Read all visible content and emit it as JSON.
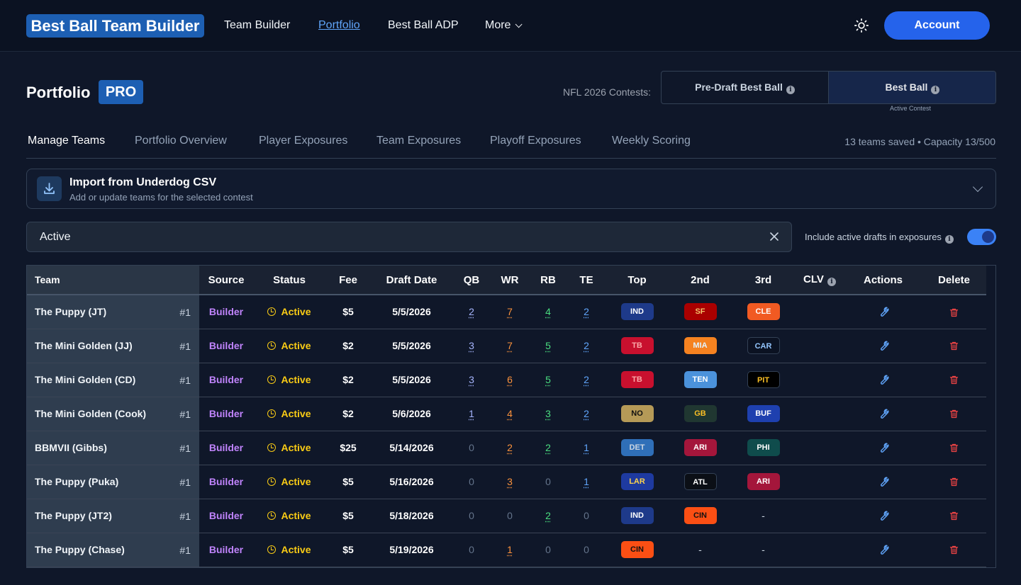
{
  "brand": "Best Ball Team Builder",
  "nav": {
    "team_builder": "Team Builder",
    "portfolio": "Portfolio",
    "adp": "Best Ball ADP",
    "more": "More"
  },
  "account_label": "Account",
  "page": {
    "title": "Portfolio",
    "badge": "PRO",
    "contest_label": "NFL 2026 Contests:",
    "contest_options": [
      "Pre-Draft Best Ball",
      "Best Ball"
    ],
    "active_contest_note": "Active Contest"
  },
  "tabs": [
    "Manage Teams",
    "Portfolio Overview",
    "Player Exposures",
    "Team Exposures",
    "Playoff Exposures",
    "Weekly Scoring"
  ],
  "saved_info": "13 teams saved • Capacity 13/500",
  "import": {
    "title": "Import from Underdog CSV",
    "subtitle": "Add or update teams for the selected contest"
  },
  "filter": {
    "value": "Active",
    "include_label": "Include active drafts in exposures",
    "include_on": true
  },
  "table": {
    "headers": [
      "Team",
      "Source",
      "Status",
      "Fee",
      "Draft Date",
      "QB",
      "WR",
      "RB",
      "TE",
      "Top",
      "2nd",
      "3rd",
      "CLV",
      "Actions",
      "Delete"
    ],
    "rows": [
      {
        "team": "The Puppy (JT)",
        "rank": "#1",
        "source": "Builder",
        "status": "Active",
        "fee": "$5",
        "date": "5/5/2026",
        "qb": "2",
        "wr": "7",
        "rb": "4",
        "te": "2",
        "top": "IND",
        "second": "SF",
        "third": "CLE"
      },
      {
        "team": "The Mini Golden (JJ)",
        "rank": "#1",
        "source": "Builder",
        "status": "Active",
        "fee": "$2",
        "date": "5/5/2026",
        "qb": "3",
        "wr": "7",
        "rb": "5",
        "te": "2",
        "top": "TB",
        "second": "MIA",
        "third": "CAR"
      },
      {
        "team": "The Mini Golden (CD)",
        "rank": "#1",
        "source": "Builder",
        "status": "Active",
        "fee": "$2",
        "date": "5/5/2026",
        "qb": "3",
        "wr": "6",
        "rb": "5",
        "te": "2",
        "top": "TB",
        "second": "TEN",
        "third": "PIT"
      },
      {
        "team": "The Mini Golden (Cook)",
        "rank": "#1",
        "source": "Builder",
        "status": "Active",
        "fee": "$2",
        "date": "5/6/2026",
        "qb": "1",
        "wr": "4",
        "rb": "3",
        "te": "2",
        "top": "NO",
        "second": "GB",
        "third": "BUF"
      },
      {
        "team": "BBMVII (Gibbs)",
        "rank": "#1",
        "source": "Builder",
        "status": "Active",
        "fee": "$25",
        "date": "5/14/2026",
        "qb": "0",
        "wr": "2",
        "rb": "2",
        "te": "1",
        "top": "DET",
        "second": "ARI",
        "third": "PHI"
      },
      {
        "team": "The Puppy (Puka)",
        "rank": "#1",
        "source": "Builder",
        "status": "Active",
        "fee": "$5",
        "date": "5/16/2026",
        "qb": "0",
        "wr": "3",
        "rb": "0",
        "te": "1",
        "top": "LAR",
        "second": "ATL",
        "third": "ARI"
      },
      {
        "team": "The Puppy (JT2)",
        "rank": "#1",
        "source": "Builder",
        "status": "Active",
        "fee": "$5",
        "date": "5/18/2026",
        "qb": "0",
        "wr": "0",
        "rb": "2",
        "te": "0",
        "top": "IND",
        "second": "CIN",
        "third": "-"
      },
      {
        "team": "The Puppy (Chase)",
        "rank": "#1",
        "source": "Builder",
        "status": "Active",
        "fee": "$5",
        "date": "5/19/2026",
        "qb": "0",
        "wr": "1",
        "rb": "0",
        "te": "0",
        "top": "CIN",
        "second": "-",
        "third": "-"
      }
    ]
  },
  "team_colors": {
    "IND": {
      "bg": "#1e3a8a",
      "fg": "#ffffff"
    },
    "SF": {
      "bg": "#aa0000",
      "fg": "#f4c26b"
    },
    "CLE": {
      "bg": "#f15a22",
      "fg": "#ffffff"
    },
    "TB": {
      "bg": "#c8102e",
      "fg": "#f9a8a8"
    },
    "MIA": {
      "bg": "#f58220",
      "fg": "#e0f2fe"
    },
    "CAR": {
      "bg": "#0b1222",
      "fg": "#93c5fd"
    },
    "TEN": {
      "bg": "#4b92db",
      "fg": "#ffffff"
    },
    "PIT": {
      "bg": "#000000",
      "fg": "#fbbf24"
    },
    "NO": {
      "bg": "#b59a57",
      "fg": "#111111"
    },
    "GB": {
      "bg": "#203731",
      "fg": "#fbbf24"
    },
    "BUF": {
      "bg": "#1e40af",
      "fg": "#ffffff"
    },
    "DET": {
      "bg": "#2f6fb8",
      "fg": "#cbd5e1"
    },
    "ARI": {
      "bg": "#a4163b",
      "fg": "#ffffff"
    },
    "PHI": {
      "bg": "#0f4c4c",
      "fg": "#ffffff"
    },
    "LAR": {
      "bg": "#1e3aa0",
      "fg": "#fcd34d"
    },
    "ATL": {
      "bg": "#0b0f16",
      "fg": "#ffffff"
    },
    "CIN": {
      "bg": "#fb4f14",
      "fg": "#111111"
    }
  },
  "icons": {
    "theme": "sun-icon",
    "import": "download-icon",
    "clear": "close-icon",
    "info": "info-icon",
    "status": "clock-icon",
    "action": "wrench-icon",
    "delete": "trash-icon"
  }
}
